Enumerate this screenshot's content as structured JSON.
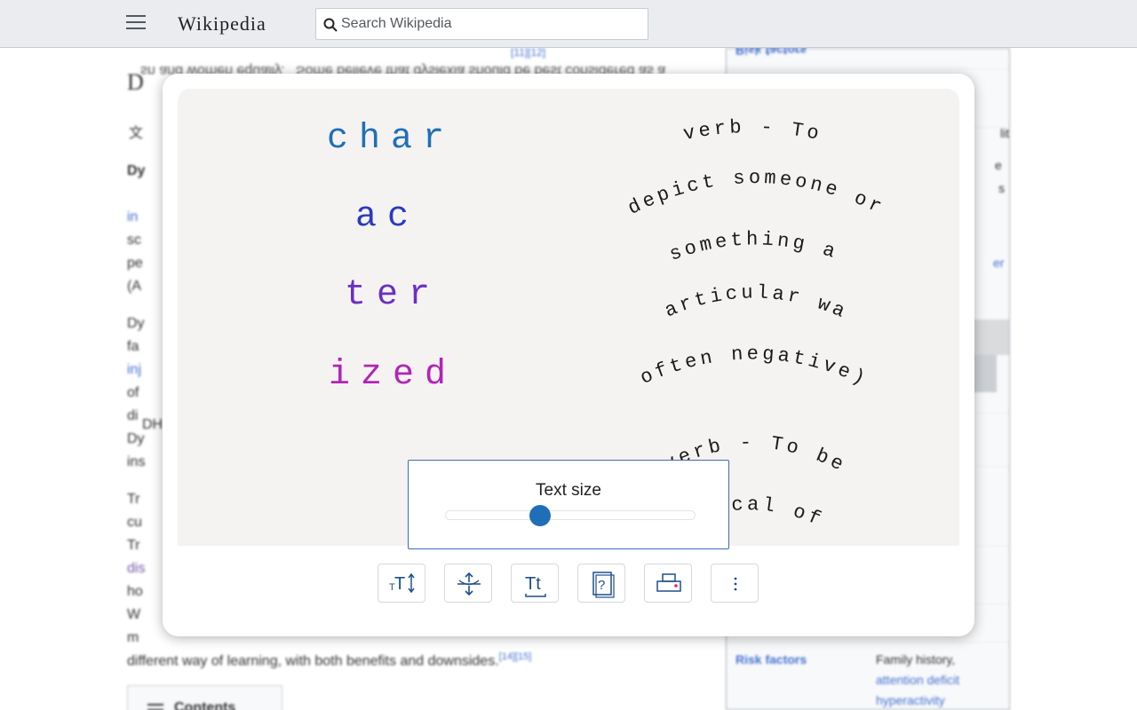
{
  "header": {
    "wordmark": "Wikipedia",
    "search_placeholder": "Search Wikipedia"
  },
  "article": {
    "lines": [
      {
        "text": "sn and women equally.",
        "flip": true
      },
      {
        "text": "Some believe that dyslexia should be best considered as a",
        "flip": true
      },
      {
        "text": "different way of learning, with both benefits and downsides.",
        "flip": false
      }
    ],
    "refs": [
      "[14][15]",
      "[11][12]"
    ],
    "fragments": [
      "D",
      "文",
      "Dy",
      "in",
      "sc",
      "pe",
      "(A",
      "Dy",
      "fa",
      "inj",
      "of",
      "di",
      "Dy",
      "ins",
      "Tr",
      "cu",
      "Tr",
      "dis",
      "ho",
      "W",
      "m",
      "DH"
    ],
    "contents_label": "Contents"
  },
  "infobox": {
    "top_row_label": "Risk factors",
    "rows": [
      {
        "label": "Risk factors",
        "value": [
          "Family history,"
        ],
        "links": [
          "attention deficit",
          "hyperactivity"
        ]
      }
    ],
    "side_fragments": [
      "lit",
      "e",
      "s",
      "er"
    ]
  },
  "reader": {
    "word_syllables": [
      {
        "text": "char",
        "color": "#1f6fb7"
      },
      {
        "text": "ac",
        "color": "#2a3bbd"
      },
      {
        "text": "ter",
        "color": "#6a2fc4"
      },
      {
        "text": "ized",
        "color": "#b224b6"
      }
    ],
    "definitions": [
      "verb - To",
      "depict someone or",
      "something a",
      "particular way",
      "(often negative).",
      "verb - To be",
      "typical of."
    ]
  },
  "popover": {
    "label": "Text size",
    "value": 0.38
  },
  "toolbar": {
    "tools": [
      {
        "name": "text-size-icon"
      },
      {
        "name": "line-spacing-icon"
      },
      {
        "name": "font-style-icon"
      },
      {
        "name": "help-book-icon"
      },
      {
        "name": "printer-icon"
      },
      {
        "name": "more-options-icon"
      }
    ]
  },
  "colors": {
    "accent": "#1f6fb7",
    "link": "#3366cc",
    "panel": "#f4f3f1"
  }
}
